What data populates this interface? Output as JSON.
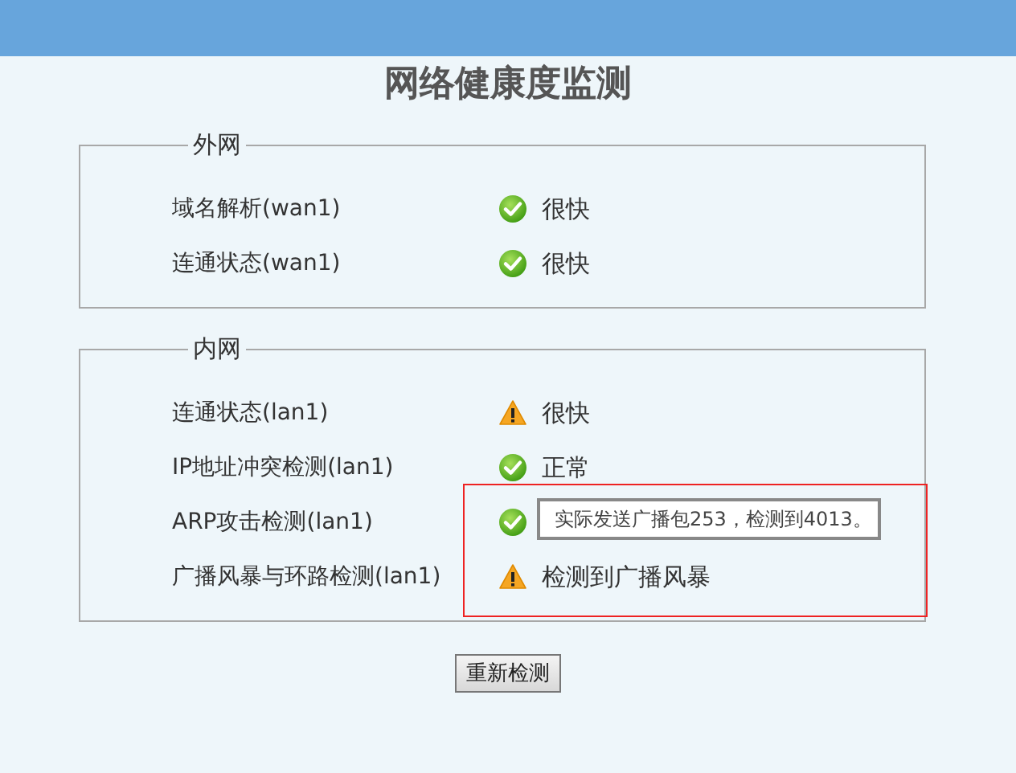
{
  "title": "网络健康度监测",
  "groups": [
    {
      "legend": "外网",
      "rows": [
        {
          "label": "域名解析(wan1)",
          "kind": "ok",
          "status": "很快"
        },
        {
          "label": "连通状态(wan1)",
          "kind": "ok",
          "status": "很快"
        }
      ]
    },
    {
      "legend": "内网",
      "rows": [
        {
          "label": "连通状态(lan1)",
          "kind": "warn",
          "status": "很快"
        },
        {
          "label": "IP地址冲突检测(lan1)",
          "kind": "ok",
          "status": "正常"
        },
        {
          "label": "ARP攻击检测(lan1)",
          "kind": "ok"
        },
        {
          "label": "广播风暴与环路检测(lan1)",
          "kind": "warn",
          "status": "检测到广播风暴"
        }
      ],
      "tooltip": "实际发送广播包253，检测到4013。"
    }
  ],
  "button": "重新检测"
}
